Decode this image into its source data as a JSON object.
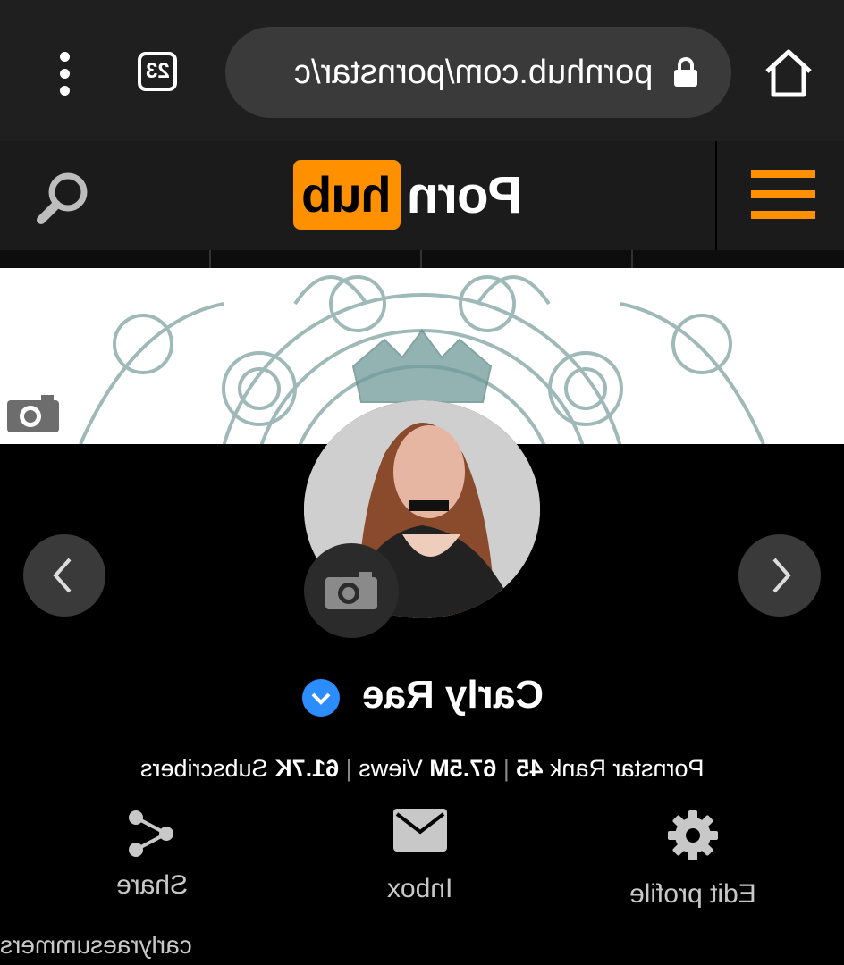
{
  "browser": {
    "tab_count": "23",
    "url": "pornhub.com/pornstar/c",
    "icons": [
      "menu-dots-icon",
      "tabs-icon",
      "lock-icon",
      "home-icon"
    ]
  },
  "header": {
    "logo_porn": "Porn",
    "logo_hub": "hub",
    "icons": [
      "search-icon",
      "hamburger-icon"
    ],
    "accent_color": "#ff9000"
  },
  "profile": {
    "name": "Carly Rae",
    "stats": {
      "rank_label": "Pornstar Rank",
      "rank_value": "45",
      "views_value": "67.5M",
      "views_label": "Views",
      "subscribers_value": "61.7K",
      "subscribers_label": "Subscribers",
      "separator": "|"
    },
    "username": "carlyraesummers"
  },
  "actions": {
    "share": "Share",
    "inbox": "Inbox",
    "edit": "Edit profile"
  },
  "colors": {
    "verified": "#2b8dff",
    "background": "#000000"
  }
}
